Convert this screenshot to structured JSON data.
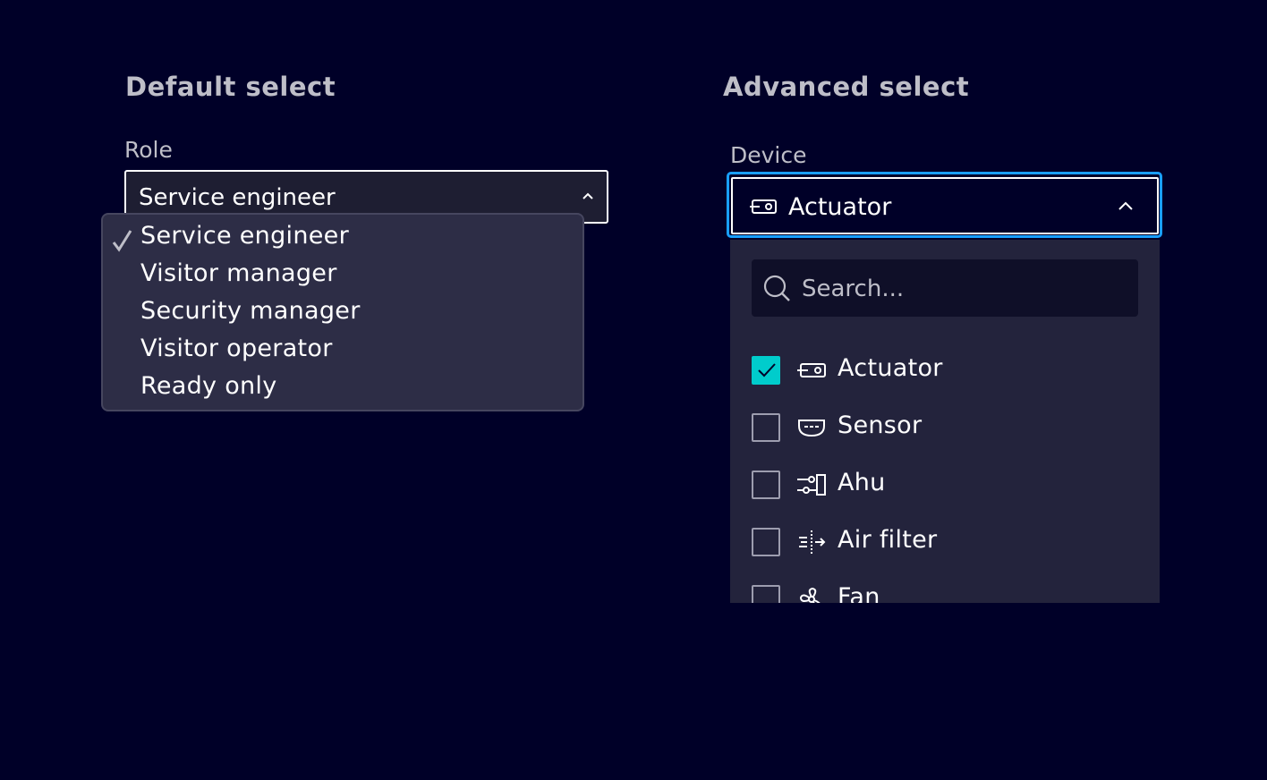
{
  "default_select": {
    "title": "Default select",
    "label": "Role",
    "value": "Service engineer",
    "options": [
      {
        "label": "Service engineer",
        "selected": true
      },
      {
        "label": "Visitor manager",
        "selected": false
      },
      {
        "label": "Security manager",
        "selected": false
      },
      {
        "label": "Visitor operator",
        "selected": false
      },
      {
        "label": "Ready only",
        "selected": false
      }
    ]
  },
  "advanced_select": {
    "title": "Advanced select",
    "label": "Device",
    "value": "Actuator",
    "value_icon": "actuator-icon",
    "search": {
      "placeholder": "Search...",
      "value": ""
    },
    "items": [
      {
        "label": "Actuator",
        "icon": "actuator-icon",
        "checked": true
      },
      {
        "label": "Sensor",
        "icon": "sensor-icon",
        "checked": false
      },
      {
        "label": "Ahu",
        "icon": "ahu-icon",
        "checked": false
      },
      {
        "label": "Air filter",
        "icon": "air-filter-icon",
        "checked": false
      },
      {
        "label": "Fan",
        "icon": "fan-icon",
        "checked": false
      }
    ]
  },
  "colors": {
    "background": "#000028",
    "accent": "#00cccc",
    "focus": "#199fff",
    "panel": "#23233c"
  }
}
